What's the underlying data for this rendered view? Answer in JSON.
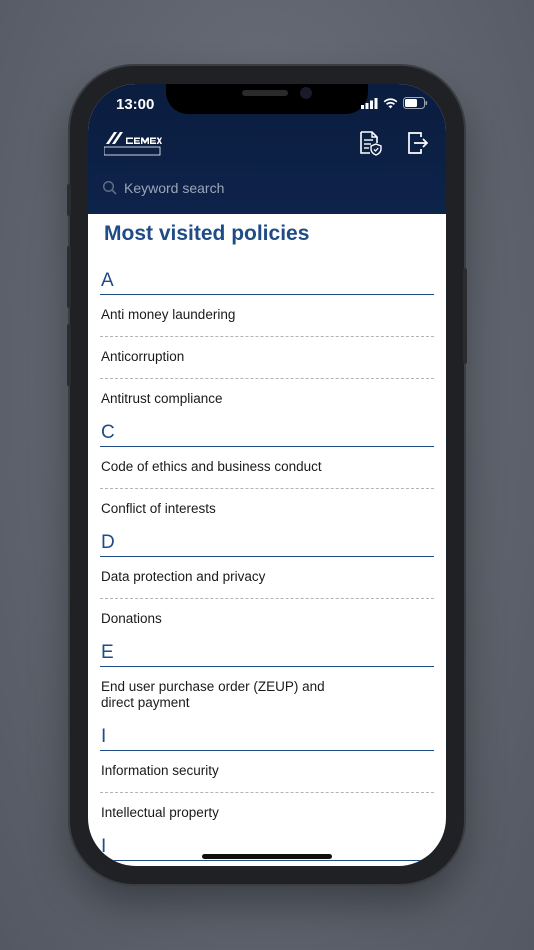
{
  "status_bar": {
    "time": "13:00"
  },
  "header": {
    "logo_text": "CEMEX",
    "logo_subtext": "POLICYCenter",
    "icons": [
      "document-shield-icon",
      "logout-icon"
    ]
  },
  "search": {
    "placeholder": "Keyword search"
  },
  "page_title": "Most visited policies",
  "sections": [
    {
      "letter": "A",
      "items": [
        "Anti money laundering",
        "Anticorruption",
        "Antitrust compliance"
      ]
    },
    {
      "letter": "C",
      "items": [
        "Code of ethics and business conduct",
        "Conflict of interests"
      ]
    },
    {
      "letter": "D",
      "items": [
        "Data protection and privacy",
        "Donations"
      ]
    },
    {
      "letter": "E",
      "items": [
        "End user purchase order (ZEUP) and direct payment"
      ]
    },
    {
      "letter": "I",
      "items": [
        "Information security",
        "Intellectual property"
      ]
    },
    {
      "letter": "I",
      "items": []
    }
  ],
  "colors": {
    "header_bg": "#0c234a",
    "accent": "#1f4b87",
    "text": "#1a1a1a"
  }
}
